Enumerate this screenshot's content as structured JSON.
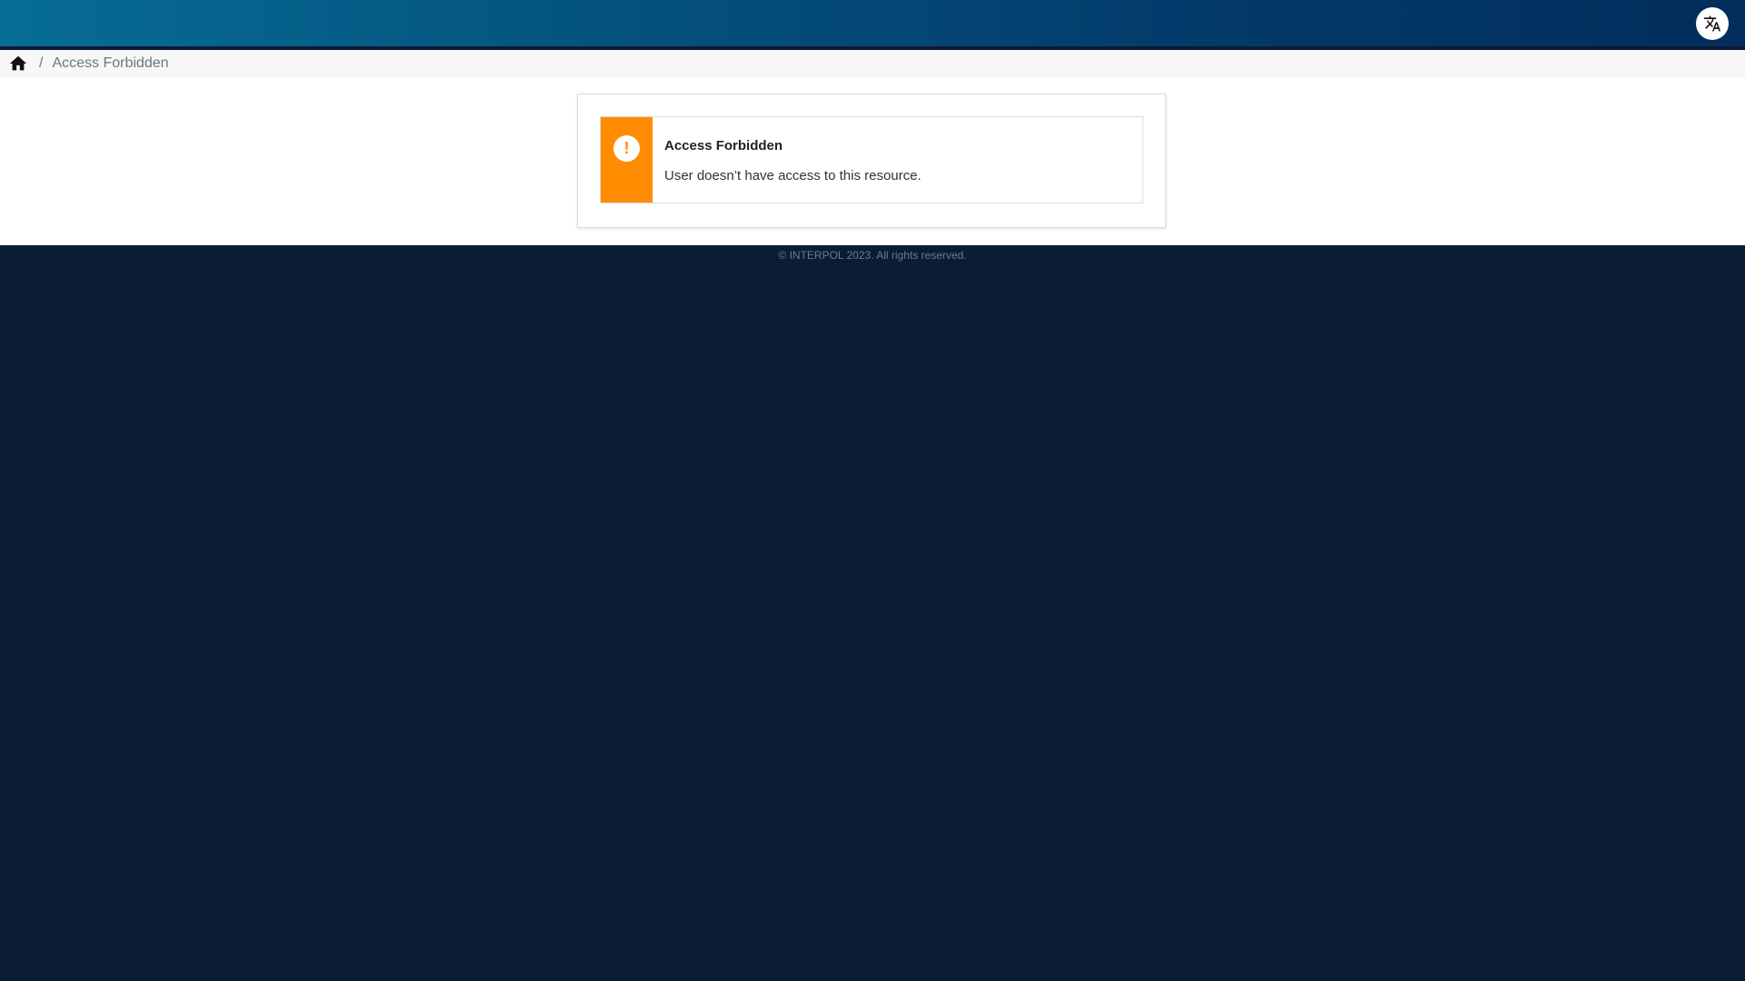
{
  "header": {
    "language_icon": "translate-icon"
  },
  "breadcrumb": {
    "home_icon": "home-icon",
    "separator": "/",
    "current": "Access Forbidden"
  },
  "alert": {
    "icon": "exclamation-icon",
    "icon_glyph": "!",
    "title": "Access Forbidden",
    "message": "User doesn’t have access to this resource.",
    "accent_color": "#ff8c00"
  },
  "footer": {
    "copyright": "© INTERPOL 2023. All rights reserved."
  },
  "colors": {
    "header_start": "#066d96",
    "header_end": "#022d5c",
    "page_background": "#0a1c36"
  }
}
